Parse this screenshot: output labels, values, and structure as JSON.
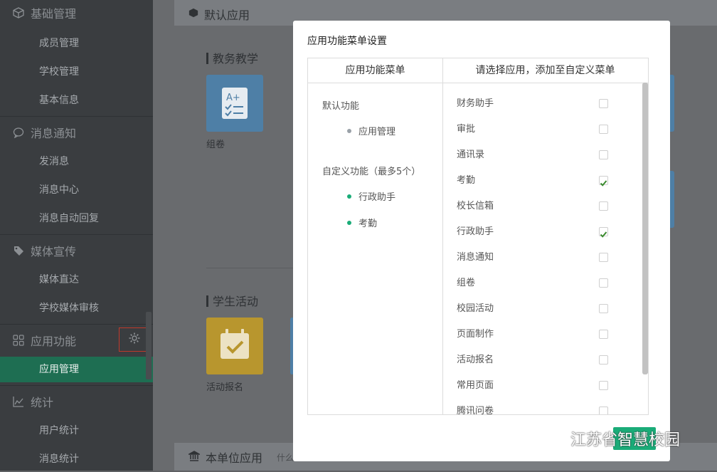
{
  "sidebar": {
    "groups": [
      {
        "label": "基础管理",
        "items": [
          "成员管理",
          "学校管理",
          "基本信息"
        ]
      },
      {
        "label": "消息通知",
        "items": [
          "发消息",
          "消息中心",
          "消息自动回复"
        ]
      },
      {
        "label": "媒体宣传",
        "items": [
          "媒体直达",
          "学校媒体审核"
        ]
      },
      {
        "label": "应用功能",
        "items": [
          "应用管理"
        ]
      },
      {
        "label": "统计",
        "items": [
          "用户统计",
          "消息统计"
        ]
      }
    ],
    "active_item": "应用管理"
  },
  "main": {
    "default_apps_title": "默认应用",
    "section_teaching": "教务教学",
    "tile_teaching_label": "组卷",
    "section_activities": "学生活动",
    "tile_activity_label": "活动报名",
    "bottom_title": "本单位应用",
    "bottom_hint": "什么"
  },
  "modal": {
    "title": "应用功能菜单设置",
    "left_header": "应用功能菜单",
    "right_header": "请选择应用，添加至自定义菜单",
    "default_label": "默认功能",
    "default_items": [
      "应用管理"
    ],
    "custom_label": "自定义功能（最多5个）",
    "custom_items": [
      "行政助手",
      "考勤"
    ],
    "apps": [
      {
        "name": "财务助手",
        "checked": false
      },
      {
        "name": "审批",
        "checked": false
      },
      {
        "name": "通讯录",
        "checked": false
      },
      {
        "name": "考勤",
        "checked": true
      },
      {
        "name": "校长信箱",
        "checked": false
      },
      {
        "name": "行政助手",
        "checked": true
      },
      {
        "name": "消息通知",
        "checked": false
      },
      {
        "name": "组卷",
        "checked": false
      },
      {
        "name": "校园活动",
        "checked": false
      },
      {
        "name": "页面制作",
        "checked": false
      },
      {
        "name": "活动报名",
        "checked": false
      },
      {
        "name": "常用页面",
        "checked": false
      },
      {
        "name": "腾讯问卷",
        "checked": false
      }
    ]
  },
  "watermark": "江苏省智慧校园",
  "colors": {
    "accent": "#1aac78",
    "sidebar_bg": "#3a3d40",
    "active_bg": "#1e6e52",
    "tile_blue": "#5b9fd8",
    "tile_yellow": "#e8b838"
  }
}
